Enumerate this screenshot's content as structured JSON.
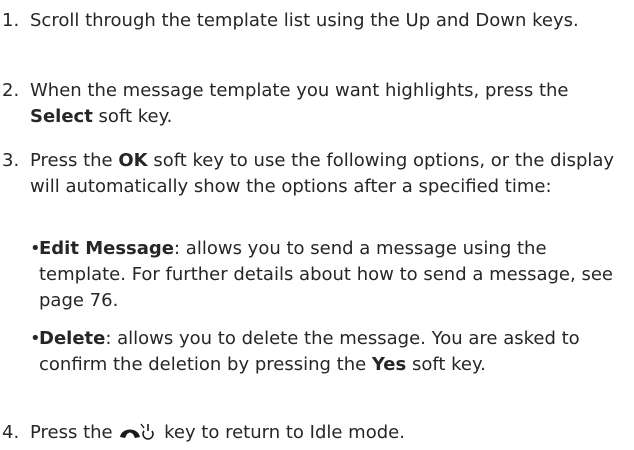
{
  "steps": [
    {
      "number": "1.",
      "text": "Scroll through the template list using the Up and Down keys."
    },
    {
      "number": "2.",
      "pre": "When the message template you want highlights, press the ",
      "bold": "Select",
      "post": " soft key."
    },
    {
      "number": "3.",
      "pre": "Press the ",
      "bold": "OK",
      "post": " soft key to use the following options, or the display will automatically show the options after a specified time:",
      "bullets": [
        {
          "marker": "•",
          "bold": "Edit Message",
          "text": ": allows you to send a message using the template. For further details about how to send a message, see page 76."
        },
        {
          "marker": "•",
          "bold": "Delete",
          "text_pre": ": allows you to delete the message. You are asked to confirm the deletion by pressing the ",
          "bold2": "Yes",
          "text_post": " soft key."
        }
      ]
    },
    {
      "number": "4.",
      "pre": "Press the ",
      "icon": "end-power-key-icon",
      "post": " key to return to Idle mode."
    }
  ]
}
